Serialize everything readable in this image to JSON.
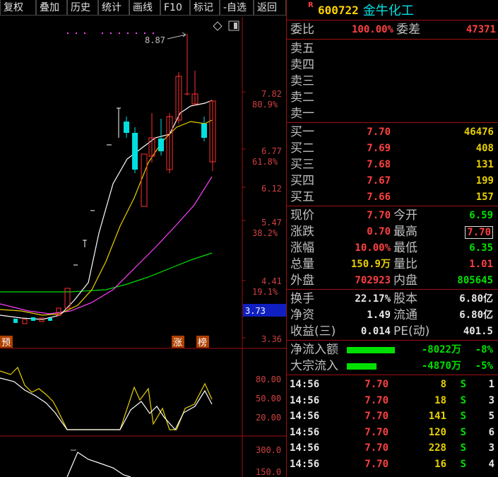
{
  "toolbar": {
    "buttons": [
      "复权",
      "叠加",
      "历史",
      "统计",
      "画线",
      "F10",
      "标记",
      "-自选",
      "返回"
    ]
  },
  "chart": {
    "price_labels": [
      "7.82",
      "80.9%",
      "6.77",
      "61.8%",
      "6.12",
      "5.47",
      "38.2%",
      "4.41",
      "19.1%",
      "3.73",
      "3.36"
    ],
    "high_annotation": "8.87",
    "markers": [
      "预",
      "涨",
      "榜"
    ],
    "osc_labels": [
      "80.00",
      "50.00",
      "20.00"
    ],
    "vol_labels": [
      "300.0",
      "150.0"
    ],
    "colors": {
      "up": "#ff3030",
      "down": "#00e0e0",
      "ma5": "#ffffff",
      "ma10": "#e8d000",
      "ma20": "#ff40ff",
      "ma60": "#00e000"
    }
  },
  "quote": {
    "r_badge": "R",
    "code": "600722",
    "name": "金牛化工",
    "webi_label": "委比",
    "webi_value": "100.00%",
    "weicha_label": "委差",
    "weicha_value": "47371",
    "asks": [
      {
        "label": "卖五"
      },
      {
        "label": "卖四"
      },
      {
        "label": "卖三"
      },
      {
        "label": "卖二"
      },
      {
        "label": "卖一"
      }
    ],
    "bids": [
      {
        "label": "买一",
        "price": "7.70",
        "vol": "46476"
      },
      {
        "label": "买二",
        "price": "7.69",
        "vol": "408"
      },
      {
        "label": "买三",
        "price": "7.68",
        "vol": "131"
      },
      {
        "label": "买四",
        "price": "7.67",
        "vol": "199"
      },
      {
        "label": "买五",
        "price": "7.66",
        "vol": "157"
      }
    ],
    "stats": [
      {
        "l1": "现价",
        "v1": "7.70",
        "c1": "red",
        "l2": "今开",
        "v2": "6.59",
        "c2": "green"
      },
      {
        "l1": "涨跌",
        "v1": "0.70",
        "c1": "red",
        "l2": "最高",
        "v2": "7.70",
        "c2": "red"
      },
      {
        "l1": "涨幅",
        "v1": "10.00%",
        "c1": "red",
        "l2": "最低",
        "v2": "6.35",
        "c2": "green"
      },
      {
        "l1": "总量",
        "v1": "150.9万",
        "c1": "yellow",
        "l2": "量比",
        "v2": "1.01",
        "c2": "red"
      },
      {
        "l1": "外盘",
        "v1": "702923",
        "c1": "red",
        "l2": "内盘",
        "v2": "805645",
        "c2": "green"
      }
    ],
    "stats2": [
      {
        "l1": "换手",
        "v1": "22.17%",
        "l2": "股本",
        "v2": "6.80亿"
      },
      {
        "l1": "净资",
        "v1": "1.49",
        "l2": "流通",
        "v2": "6.80亿"
      },
      {
        "l1": "收益(三)",
        "v1": "0.014",
        "l2": "PE(动)",
        "v2": "401.5"
      }
    ],
    "flows": [
      {
        "label": "净流入额",
        "value": "-8022万",
        "pct": "-8%"
      },
      {
        "label": "大宗流入",
        "value": "-4870万",
        "pct": "-5%"
      }
    ],
    "ticks": [
      {
        "time": "14:56",
        "price": "7.70",
        "vol": "8",
        "side": "S",
        "n": "1"
      },
      {
        "time": "14:56",
        "price": "7.70",
        "vol": "18",
        "side": "S",
        "n": "3"
      },
      {
        "time": "14:56",
        "price": "7.70",
        "vol": "141",
        "side": "S",
        "n": "5"
      },
      {
        "time": "14:56",
        "price": "7.70",
        "vol": "120",
        "side": "S",
        "n": "6"
      },
      {
        "time": "14:56",
        "price": "7.70",
        "vol": "228",
        "side": "S",
        "n": "3"
      },
      {
        "time": "14:56",
        "price": "7.70",
        "vol": "16",
        "side": "S",
        "n": "4"
      }
    ]
  }
}
